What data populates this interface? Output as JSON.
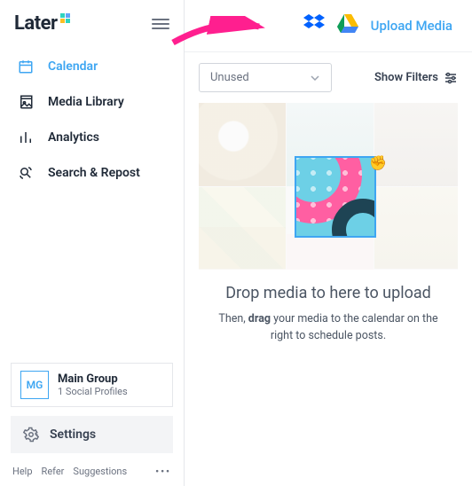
{
  "logo": {
    "text": "Later"
  },
  "nav": {
    "items": [
      {
        "label": "Calendar",
        "active": true
      },
      {
        "label": "Media Library"
      },
      {
        "label": "Analytics"
      },
      {
        "label": "Search & Repost"
      }
    ]
  },
  "group": {
    "badge": "MG",
    "name": "Main Group",
    "sub": "1 Social Profiles"
  },
  "settings": {
    "label": "Settings"
  },
  "footer": {
    "help": "Help",
    "refer": "Refer",
    "suggestions": "Suggestions"
  },
  "topbar": {
    "upload": "Upload Media"
  },
  "filterbar": {
    "dropdown": "Unused",
    "show_filters": "Show Filters"
  },
  "drop": {
    "title": "Drop media to here to upload",
    "sub_pre": "Then, ",
    "sub_bold": "drag",
    "sub_post": " your media to the calendar on the right to schedule posts."
  },
  "colors": {
    "accent": "#3EA6F2"
  }
}
